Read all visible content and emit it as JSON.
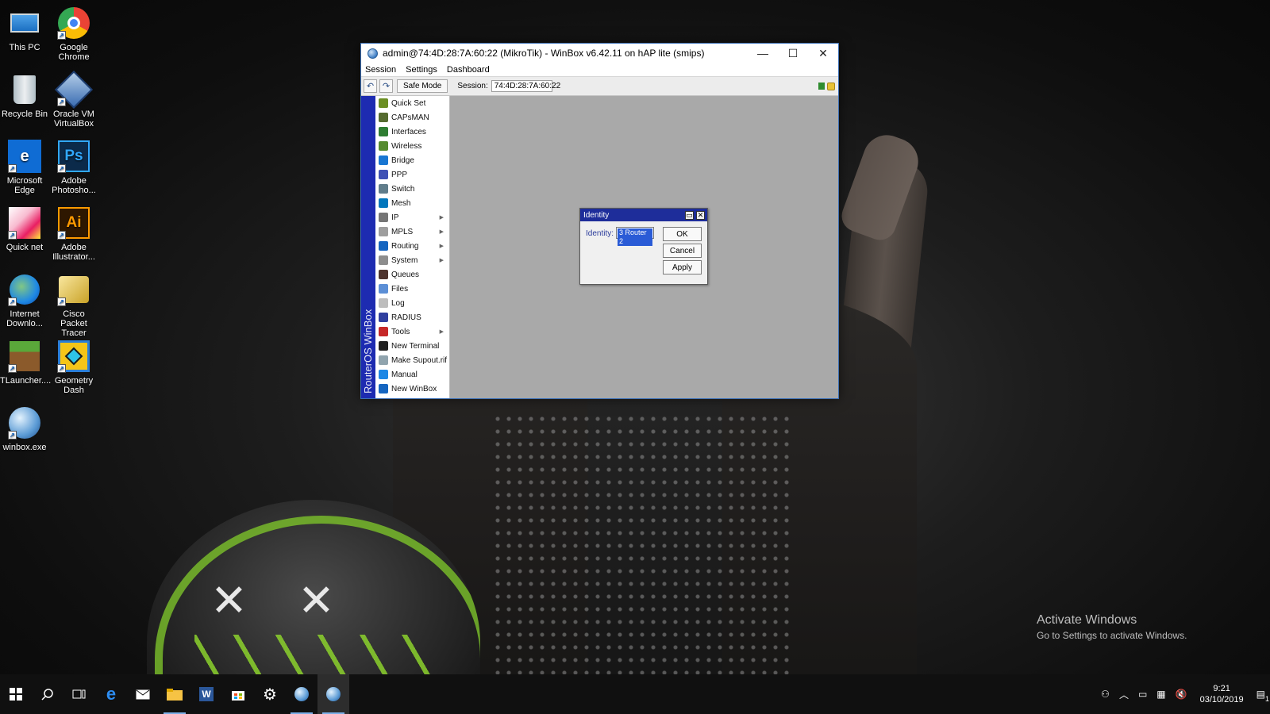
{
  "desktop": {
    "icons": [
      {
        "label": "This PC"
      },
      {
        "label": "Google Chrome"
      },
      {
        "label": "Recycle Bin"
      },
      {
        "label": "Oracle VM VirtualBox"
      },
      {
        "label": "Microsoft Edge"
      },
      {
        "label": "Adobe Photosho..."
      },
      {
        "label": "Quick net"
      },
      {
        "label": "Adobe Illustrator..."
      },
      {
        "label": "Internet Downlo..."
      },
      {
        "label": "Cisco Packet Tracer"
      },
      {
        "label": "TLauncher...."
      },
      {
        "label": "Geometry Dash"
      },
      {
        "label": "winbox.exe"
      }
    ]
  },
  "winbox": {
    "title": "admin@74:4D:28:7A:60:22 (MikroTik) - WinBox v6.42.11 on hAP lite (smips)",
    "menu": [
      "Session",
      "Settings",
      "Dashboard"
    ],
    "toolbar": {
      "safe_mode": "Safe Mode",
      "session_label": "Session:",
      "session_value": "74:4D:28:7A:60:22"
    },
    "brand_strip": "RouterOS WinBox",
    "sidebar": [
      {
        "label": "Quick Set",
        "color": "#6b8e23",
        "submenu": false
      },
      {
        "label": "CAPsMAN",
        "color": "#556b2f",
        "submenu": false
      },
      {
        "label": "Interfaces",
        "color": "#2e7d32",
        "submenu": false
      },
      {
        "label": "Wireless",
        "color": "#558b2f",
        "submenu": false
      },
      {
        "label": "Bridge",
        "color": "#1976d2",
        "submenu": false
      },
      {
        "label": "PPP",
        "color": "#3f51b5",
        "submenu": false
      },
      {
        "label": "Switch",
        "color": "#607d8b",
        "submenu": false
      },
      {
        "label": "Mesh",
        "color": "#0277bd",
        "submenu": false
      },
      {
        "label": "IP",
        "color": "#757575",
        "submenu": true
      },
      {
        "label": "MPLS",
        "color": "#9e9e9e",
        "submenu": true
      },
      {
        "label": "Routing",
        "color": "#1565c0",
        "submenu": true
      },
      {
        "label": "System",
        "color": "#8d8d8d",
        "submenu": true
      },
      {
        "label": "Queues",
        "color": "#4e342e",
        "submenu": false
      },
      {
        "label": "Files",
        "color": "#5c8fd6",
        "submenu": false
      },
      {
        "label": "Log",
        "color": "#bdbdbd",
        "submenu": false
      },
      {
        "label": "RADIUS",
        "color": "#303f9f",
        "submenu": false
      },
      {
        "label": "Tools",
        "color": "#c62828",
        "submenu": true
      },
      {
        "label": "New Terminal",
        "color": "#212121",
        "submenu": false
      },
      {
        "label": "Make Supout.rif",
        "color": "#90a4ae",
        "submenu": false
      },
      {
        "label": "Manual",
        "color": "#1e88e5",
        "submenu": false
      },
      {
        "label": "New WinBox",
        "color": "#1565c0",
        "submenu": false
      }
    ]
  },
  "identity_dialog": {
    "title": "Identity",
    "field_label": "Identity:",
    "field_value": "3 Router 2",
    "ok": "OK",
    "cancel": "Cancel",
    "apply": "Apply"
  },
  "watermark": {
    "line1": "Activate Windows",
    "line2": "Go to Settings to activate Windows."
  },
  "taskbar": {
    "time": "9:21",
    "date": "03/10/2019",
    "notification_count": "1"
  }
}
